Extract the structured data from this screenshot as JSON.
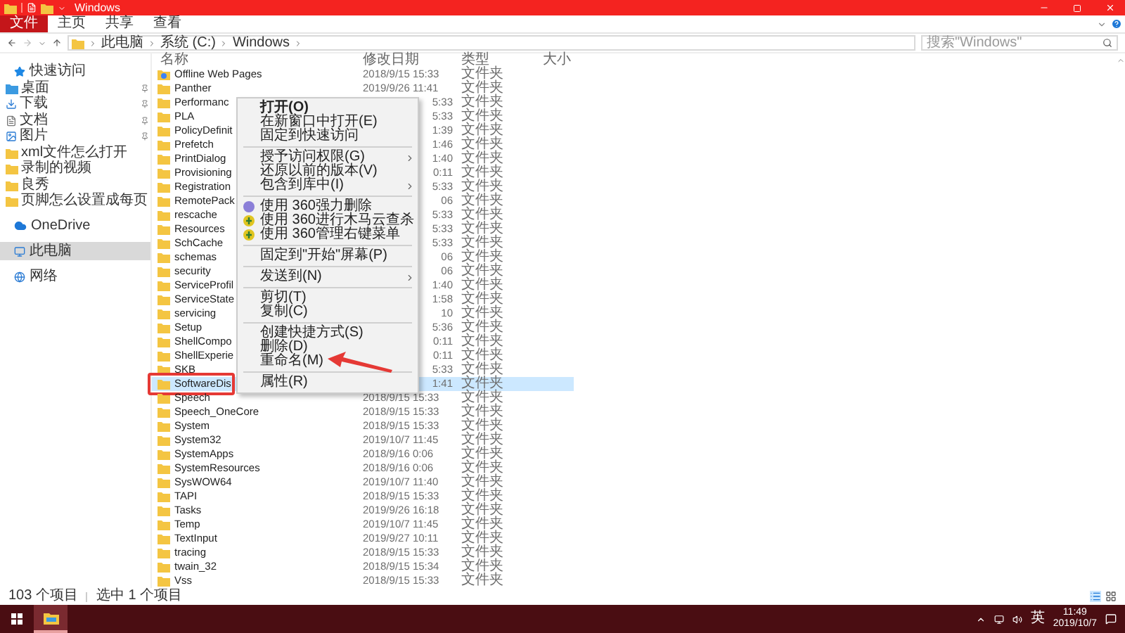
{
  "window": {
    "title": "Windows"
  },
  "ribbon_tabs": [
    {
      "label": "文件",
      "selected": true
    },
    {
      "label": "主页",
      "selected": false
    },
    {
      "label": "共享",
      "selected": false
    },
    {
      "label": "查看",
      "selected": false
    }
  ],
  "address": {
    "path": [
      "此电脑",
      "系统 (C:)",
      "Windows"
    ]
  },
  "search": {
    "placeholder": "搜索\"Windows\""
  },
  "sidebar": {
    "items": [
      {
        "label": "快速访问",
        "kind": "star",
        "selected": false,
        "children": [
          {
            "label": "桌面",
            "kind": "desktop",
            "pinned": true,
            "selected": false
          },
          {
            "label": "下载",
            "kind": "download",
            "pinned": true,
            "selected": false
          },
          {
            "label": "文档",
            "kind": "document",
            "pinned": true,
            "selected": false
          },
          {
            "label": "图片",
            "kind": "image",
            "pinned": true,
            "selected": false
          },
          {
            "label": "xml文件怎么打开",
            "kind": "folder",
            "pinned": false,
            "selected": false
          },
          {
            "label": "录制的视频",
            "kind": "folder",
            "pinned": false,
            "selected": false
          },
          {
            "label": "良秀",
            "kind": "folder",
            "pinned": false,
            "selected": false
          },
          {
            "label": "页脚怎么设置成每页",
            "kind": "folder",
            "pinned": false,
            "selected": false
          }
        ]
      },
      {
        "label": "OneDrive",
        "kind": "cloud",
        "selected": false
      },
      {
        "label": "此电脑",
        "kind": "pc",
        "selected": true
      },
      {
        "label": "网络",
        "kind": "network",
        "selected": false
      }
    ]
  },
  "table": {
    "columns": [
      "名称",
      "修改日期",
      "类型",
      "大小"
    ],
    "rows": [
      {
        "name": "Offline Web Pages",
        "date": "2018/9/15 15:33",
        "type": "文件夹",
        "kind": "web_folder",
        "clipped": false,
        "selected": false,
        "annotated": false
      },
      {
        "name": "Panther",
        "date": "2019/9/26 11:41",
        "type": "文件夹",
        "kind": "folder",
        "clipped": false,
        "selected": false,
        "annotated": false
      },
      {
        "name": "Performanc",
        "date": "5:33",
        "type": "文件夹",
        "kind": "folder",
        "clipped": true,
        "selected": false,
        "annotated": false
      },
      {
        "name": "PLA",
        "date": "5:33",
        "type": "文件夹",
        "kind": "folder",
        "clipped": true,
        "selected": false,
        "annotated": false
      },
      {
        "name": "PolicyDefinit",
        "date": "1:39",
        "type": "文件夹",
        "kind": "folder",
        "clipped": true,
        "selected": false,
        "annotated": false
      },
      {
        "name": "Prefetch",
        "date": "1:46",
        "type": "文件夹",
        "kind": "folder",
        "clipped": true,
        "selected": false,
        "annotated": false
      },
      {
        "name": "PrintDialog",
        "date": "1:40",
        "type": "文件夹",
        "kind": "folder",
        "clipped": true,
        "selected": false,
        "annotated": false
      },
      {
        "name": "Provisioning",
        "date": "0:11",
        "type": "文件夹",
        "kind": "folder",
        "clipped": true,
        "selected": false,
        "annotated": false
      },
      {
        "name": "Registration",
        "date": "5:33",
        "type": "文件夹",
        "kind": "folder",
        "clipped": true,
        "selected": false,
        "annotated": false
      },
      {
        "name": "RemotePack",
        "date": "06",
        "type": "文件夹",
        "kind": "folder",
        "clipped": true,
        "selected": false,
        "annotated": false
      },
      {
        "name": "rescache",
        "date": "5:33",
        "type": "文件夹",
        "kind": "folder",
        "clipped": true,
        "selected": false,
        "annotated": false
      },
      {
        "name": "Resources",
        "date": "5:33",
        "type": "文件夹",
        "kind": "folder",
        "clipped": true,
        "selected": false,
        "annotated": false
      },
      {
        "name": "SchCache",
        "date": "5:33",
        "type": "文件夹",
        "kind": "folder",
        "clipped": true,
        "selected": false,
        "annotated": false
      },
      {
        "name": "schemas",
        "date": "06",
        "type": "文件夹",
        "kind": "folder",
        "clipped": true,
        "selected": false,
        "annotated": false
      },
      {
        "name": "security",
        "date": "06",
        "type": "文件夹",
        "kind": "folder",
        "clipped": true,
        "selected": false,
        "annotated": false
      },
      {
        "name": "ServiceProfil",
        "date": "1:40",
        "type": "文件夹",
        "kind": "folder",
        "clipped": true,
        "selected": false,
        "annotated": false
      },
      {
        "name": "ServiceState",
        "date": "1:58",
        "type": "文件夹",
        "kind": "folder",
        "clipped": true,
        "selected": false,
        "annotated": false
      },
      {
        "name": "servicing",
        "date": "10",
        "type": "文件夹",
        "kind": "folder",
        "clipped": true,
        "selected": false,
        "annotated": false
      },
      {
        "name": "Setup",
        "date": "5:36",
        "type": "文件夹",
        "kind": "folder",
        "clipped": true,
        "selected": false,
        "annotated": false
      },
      {
        "name": "ShellCompo",
        "date": "0:11",
        "type": "文件夹",
        "kind": "folder",
        "clipped": true,
        "selected": false,
        "annotated": false
      },
      {
        "name": "ShellExperie",
        "date": "0:11",
        "type": "文件夹",
        "kind": "folder",
        "clipped": true,
        "selected": false,
        "annotated": false
      },
      {
        "name": "SKB",
        "date": "5:33",
        "type": "文件夹",
        "kind": "folder",
        "clipped": true,
        "selected": false,
        "annotated": false
      },
      {
        "name": "SoftwareDis",
        "date": "1:41",
        "type": "文件夹",
        "kind": "folder",
        "clipped": true,
        "selected": true,
        "annotated": true
      },
      {
        "name": "Speech",
        "date": "2018/9/15 15:33",
        "type": "文件夹",
        "kind": "folder",
        "clipped": false,
        "selected": false,
        "annotated": false
      },
      {
        "name": "Speech_OneCore",
        "date": "2018/9/15 15:33",
        "type": "文件夹",
        "kind": "folder",
        "clipped": false,
        "selected": false,
        "annotated": false
      },
      {
        "name": "System",
        "date": "2018/9/15 15:33",
        "type": "文件夹",
        "kind": "folder",
        "clipped": false,
        "selected": false,
        "annotated": false
      },
      {
        "name": "System32",
        "date": "2019/10/7 11:45",
        "type": "文件夹",
        "kind": "folder",
        "clipped": false,
        "selected": false,
        "annotated": false
      },
      {
        "name": "SystemApps",
        "date": "2018/9/16 0:06",
        "type": "文件夹",
        "kind": "folder",
        "clipped": false,
        "selected": false,
        "annotated": false
      },
      {
        "name": "SystemResources",
        "date": "2018/9/16 0:06",
        "type": "文件夹",
        "kind": "folder",
        "clipped": false,
        "selected": false,
        "annotated": false
      },
      {
        "name": "SysWOW64",
        "date": "2019/10/7 11:40",
        "type": "文件夹",
        "kind": "folder",
        "clipped": false,
        "selected": false,
        "annotated": false
      },
      {
        "name": "TAPI",
        "date": "2018/9/15 15:33",
        "type": "文件夹",
        "kind": "folder",
        "clipped": false,
        "selected": false,
        "annotated": false
      },
      {
        "name": "Tasks",
        "date": "2019/9/26 16:18",
        "type": "文件夹",
        "kind": "folder",
        "clipped": false,
        "selected": false,
        "annotated": false
      },
      {
        "name": "Temp",
        "date": "2019/10/7 11:45",
        "type": "文件夹",
        "kind": "folder",
        "clipped": false,
        "selected": false,
        "annotated": false
      },
      {
        "name": "TextInput",
        "date": "2019/9/27 10:11",
        "type": "文件夹",
        "kind": "folder",
        "clipped": false,
        "selected": false,
        "annotated": false
      },
      {
        "name": "tracing",
        "date": "2018/9/15 15:33",
        "type": "文件夹",
        "kind": "folder",
        "clipped": false,
        "selected": false,
        "annotated": false
      },
      {
        "name": "twain_32",
        "date": "2018/9/15 15:34",
        "type": "文件夹",
        "kind": "folder",
        "clipped": false,
        "selected": false,
        "annotated": false
      },
      {
        "name": "Vss",
        "date": "2018/9/15 15:33",
        "type": "文件夹",
        "kind": "folder",
        "clipped": false,
        "selected": false,
        "annotated": false
      }
    ]
  },
  "context_menu": {
    "items": [
      {
        "kind": "item",
        "label": "打开(O)",
        "bold": true,
        "submenu": false,
        "pointed": false
      },
      {
        "kind": "item",
        "label": "在新窗口中打开(E)",
        "bold": false,
        "submenu": false,
        "pointed": false
      },
      {
        "kind": "item",
        "label": "固定到快速访问",
        "bold": false,
        "submenu": false,
        "pointed": false
      },
      {
        "kind": "separator"
      },
      {
        "kind": "item",
        "label": "授予访问权限(G)",
        "bold": false,
        "submenu": true,
        "pointed": false
      },
      {
        "kind": "item",
        "label": "还原以前的版本(V)",
        "bold": false,
        "submenu": false,
        "pointed": false
      },
      {
        "kind": "item",
        "label": "包含到库中(I)",
        "bold": false,
        "submenu": true,
        "pointed": false
      },
      {
        "kind": "separator"
      },
      {
        "kind": "shield_purple",
        "label": "使用 360强力删除",
        "bold": false,
        "submenu": false,
        "pointed": false
      },
      {
        "kind": "shield_green",
        "label": "使用 360进行木马云查杀",
        "bold": false,
        "submenu": false,
        "pointed": false
      },
      {
        "kind": "shield_green",
        "label": "使用 360管理右键菜单",
        "bold": false,
        "submenu": false,
        "pointed": false
      },
      {
        "kind": "separator"
      },
      {
        "kind": "item",
        "label": "固定到\"开始\"屏幕(P)",
        "bold": false,
        "submenu": false,
        "pointed": false
      },
      {
        "kind": "separator"
      },
      {
        "kind": "item",
        "label": "发送到(N)",
        "bold": false,
        "submenu": true,
        "pointed": false
      },
      {
        "kind": "separator"
      },
      {
        "kind": "item",
        "label": "剪切(T)",
        "bold": false,
        "submenu": false,
        "pointed": false
      },
      {
        "kind": "item",
        "label": "复制(C)",
        "bold": false,
        "submenu": false,
        "pointed": false
      },
      {
        "kind": "separator"
      },
      {
        "kind": "item",
        "label": "创建快捷方式(S)",
        "bold": false,
        "submenu": false,
        "pointed": false
      },
      {
        "kind": "item",
        "label": "删除(D)",
        "bold": false,
        "submenu": false,
        "pointed": false
      },
      {
        "kind": "item",
        "label": "重命名(M)",
        "bold": false,
        "submenu": false,
        "pointed": true
      },
      {
        "kind": "separator"
      },
      {
        "kind": "item",
        "label": "属性(R)",
        "bold": false,
        "submenu": false,
        "pointed": false
      }
    ]
  },
  "status_bar": {
    "count": "103 个项目",
    "selection": "选中 1 个项目"
  },
  "taskbar": {
    "apps": [
      {
        "kind": "start",
        "active": false
      },
      {
        "kind": "explorer",
        "active": true
      }
    ],
    "ime": "英",
    "time": "11:49",
    "date": "2019/10/7"
  }
}
